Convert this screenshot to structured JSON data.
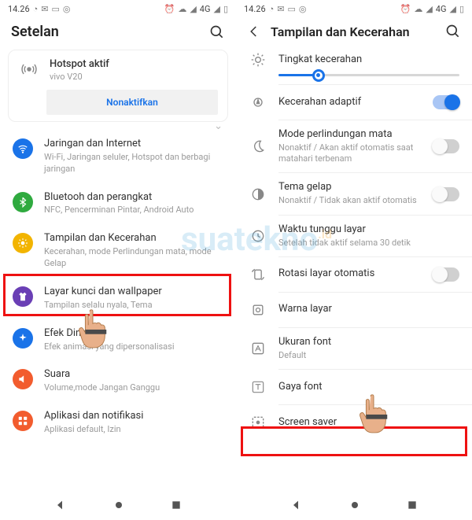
{
  "statusbar": {
    "time": "14.26",
    "network": "4G"
  },
  "left": {
    "title": "Setelan",
    "hotspot": {
      "title": "Hotspot aktif",
      "subtitle": "vivo V20",
      "button": "Nonaktifkan"
    },
    "rows": [
      {
        "icon": "wifi",
        "bg": "#1a73e8",
        "title": "Jaringan dan Internet",
        "sub": "Wi-Fi, Jaringan seluler, Hotspot dan berbagi jaringan"
      },
      {
        "icon": "bt",
        "bg": "#2faa3f",
        "title": "Bluetooh dan perangkat",
        "sub": "NFC, Pencerminan Pintar, Android Auto"
      },
      {
        "icon": "sun",
        "bg": "#f2b400",
        "title": "Tampilan dan Kecerahan",
        "sub": "Kecerahan, mode Perlindungan mata, mode Gelap"
      },
      {
        "icon": "shirt",
        "bg": "#6a3fb5",
        "title": "Layar kunci dan wallpaper",
        "sub": "Tampilan selalu nyala, Tema"
      },
      {
        "icon": "sparkle",
        "bg": "#1a73e8",
        "title": "Efek Dinamis",
        "sub": "Efek animasi yang dipersonalisasi"
      },
      {
        "icon": "sound",
        "bg": "#f25c2e",
        "title": "Suara",
        "sub": "Volume,mode Jangan Ganggu"
      },
      {
        "icon": "apps",
        "bg": "#f25c2e",
        "title": "Aplikasi dan notifikasi",
        "sub": "Aplikasi default, Izin"
      }
    ]
  },
  "right": {
    "title": "Tampilan dan Kecerahan",
    "brightness_label": "Tingkat kecerahan",
    "brightness_pct": 22,
    "rows": [
      {
        "icon": "brightness-auto",
        "title": "Kecerahan adaptif",
        "sub": "",
        "toggle": "on"
      },
      {
        "icon": "moon",
        "title": "Mode perlindungan mata",
        "sub": "Nonaktif / Akan aktif otomatis saat matahari terbenam",
        "toggle": "off"
      },
      {
        "icon": "contrast",
        "title": "Tema gelap",
        "sub": "Nonaktif / Tidak akan aktif otomatis",
        "toggle": "off"
      },
      {
        "icon": "clock",
        "title": "Waktu tunggu layar",
        "sub": "Setelah tidak aktif selama 30 detik"
      },
      {
        "icon": "rotate",
        "title": "Rotasi layar otomatis",
        "sub": "",
        "toggle": "off"
      },
      {
        "icon": "palette",
        "title": "Warna layar",
        "sub": ""
      },
      {
        "icon": "fontsize",
        "title": "Ukuran font",
        "sub": "Default"
      },
      {
        "icon": "fontstyle",
        "title": "Gaya font",
        "sub": ""
      },
      {
        "icon": "screensaver",
        "title": "Screen saver",
        "sub": ""
      }
    ]
  },
  "watermark": "suatekno"
}
